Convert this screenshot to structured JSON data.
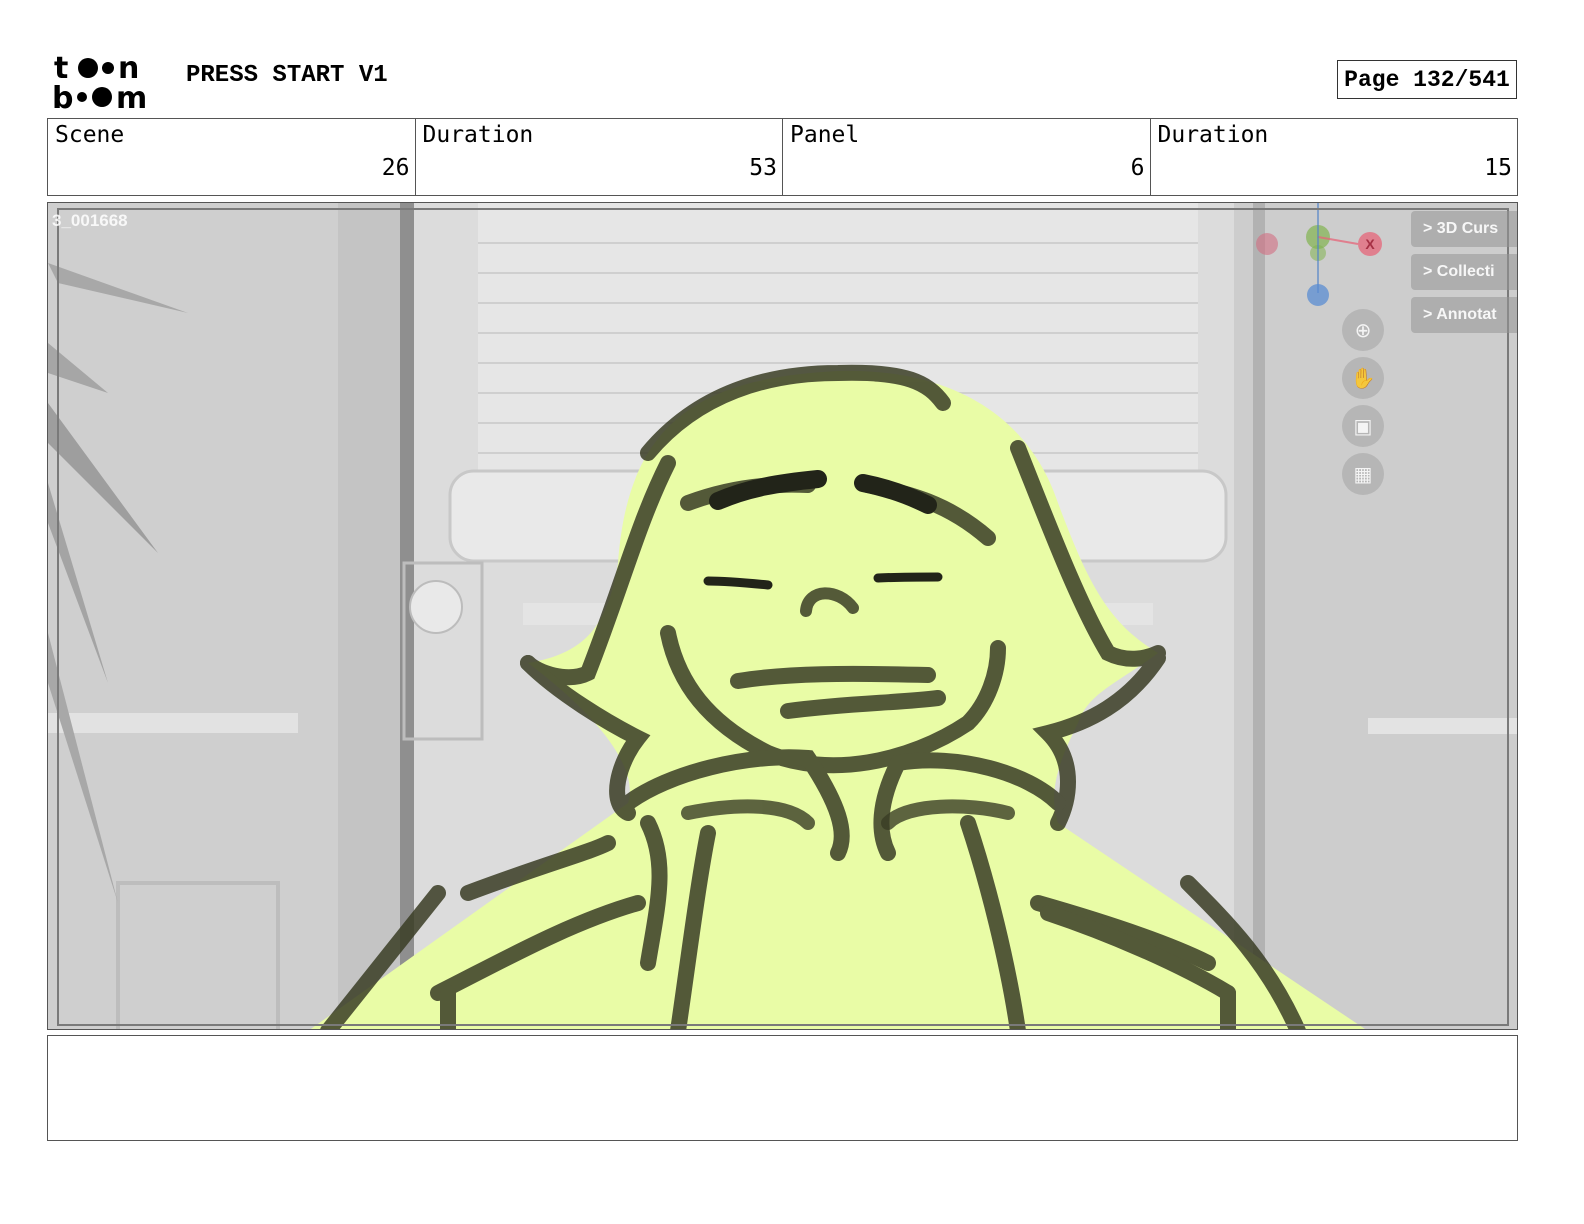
{
  "header": {
    "project_title": "PRESS START V1",
    "page_label": "Page 132/541"
  },
  "info": {
    "scene_label": "Scene",
    "scene_value": "26",
    "scene_duration_label": "Duration",
    "scene_duration_value": "53",
    "panel_label": "Panel",
    "panel_value": "6",
    "panel_duration_label": "Duration",
    "panel_duration_value": "15"
  },
  "panel": {
    "frame_label": "3_001668",
    "buttons": [
      "> 3D Curs",
      "> Collecti",
      "> Annotat"
    ],
    "gizmo_x": "X",
    "tools": [
      "zoom-icon",
      "hand-icon",
      "camera-icon",
      "grid-icon"
    ]
  },
  "notes": {
    "text": ""
  },
  "colors": {
    "character_fill": "#e9fca6",
    "character_line": "#3a3d25",
    "background": "#d4d4d4"
  }
}
